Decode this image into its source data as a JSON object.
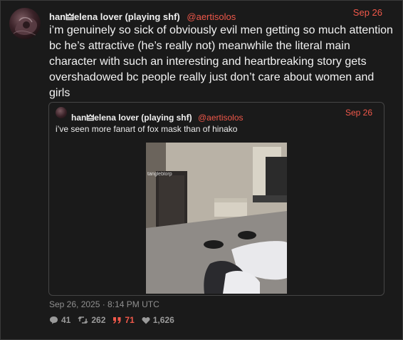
{
  "post": {
    "display_name": "han🜲elena lover (playing shf)",
    "handle": "@aertisolos",
    "date": "Sep 26",
    "text": "i’m genuinely so sick of obviously evil men getting so much attention bc he’s attractive (he’s really not) meanwhile the literal main character with such an interesting and heartbreaking story gets overshadowed bc people really just don’t care about women and girls",
    "timestamp": "Sep 26, 2025 · 8:14 PM UTC"
  },
  "quoted": {
    "display_name": "han🜲elena lover (playing shf)",
    "handle": "@aertisolos",
    "date": "Sep 26",
    "text": "i’ve seen more fanart of fox mask than of hinako",
    "media_watermark": "tangleblorp"
  },
  "stats": {
    "replies": "41",
    "reposts": "262",
    "quotes": "71",
    "likes": "1,626"
  },
  "colors": {
    "accent": "#f0584a",
    "background": "#1a1a1a",
    "border": "#454545"
  },
  "icons": {
    "replies": "comment-icon",
    "reposts": "repost-icon",
    "quotes": "quote-icon",
    "likes": "heart-icon"
  }
}
